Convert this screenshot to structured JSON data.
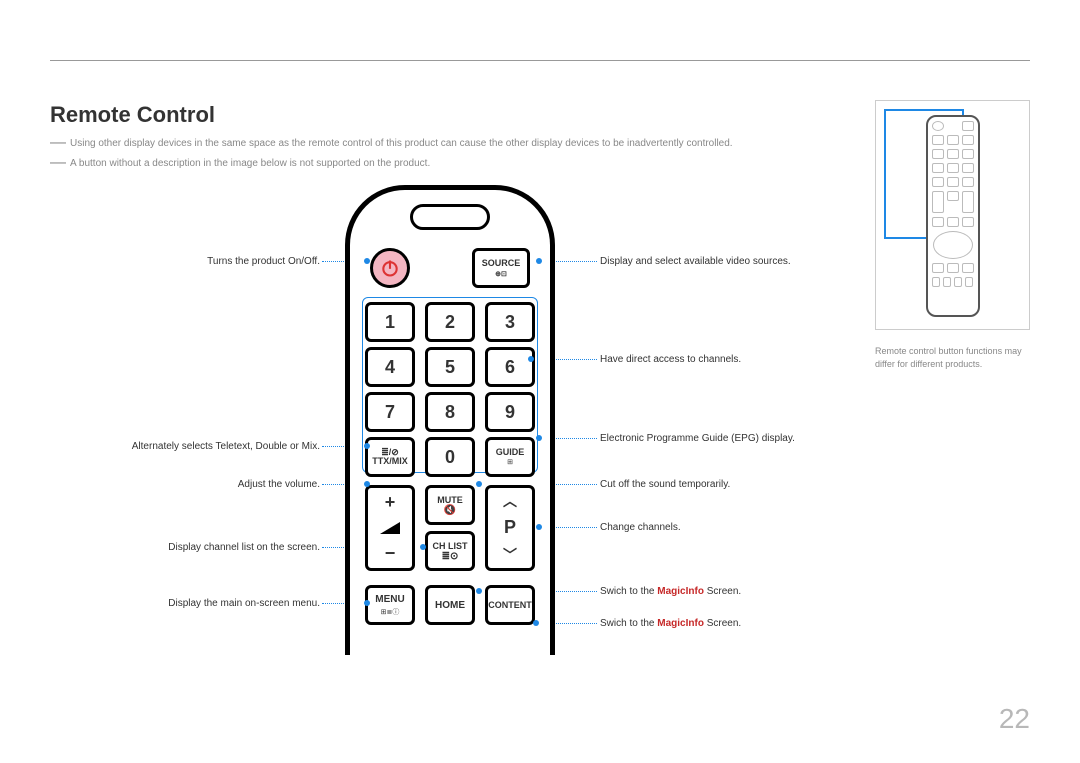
{
  "title": "Remote Control",
  "notes": {
    "n1": "Using other display devices in the same space as the remote control of this product can cause the other display devices to be inadvertently controlled.",
    "n2": "A button without a description in the image below is not supported on the product."
  },
  "callouts": {
    "left": {
      "power": "Turns the product On/Off.",
      "ttx": "Alternately selects Teletext, Double or Mix.",
      "vol": "Adjust the volume.",
      "chlist": "Display channel list on the screen.",
      "menu": "Display the main on-screen menu."
    },
    "right": {
      "source": "Display and select available video sources.",
      "num": "Have direct access to channels.",
      "guide": "Electronic Programme Guide (EPG) display.",
      "mute": "Cut off the sound temporarily.",
      "prog": "Change channels.",
      "home_pre": "Swich to the ",
      "home_b": "MagicInfo",
      "home_post": " Screen.",
      "content_pre": "Swich to the ",
      "content_b": "MagicInfo",
      "content_post": " Screen."
    }
  },
  "buttons": {
    "source": "SOURCE",
    "n1": "1",
    "n2": "2",
    "n3": "3",
    "n4": "4",
    "n5": "5",
    "n6": "6",
    "n7": "7",
    "n8": "8",
    "n9": "9",
    "n0": "0",
    "ttx": "TTX/MIX",
    "guide": "GUIDE",
    "mute": "MUTE",
    "chlist": "CH LIST",
    "p": "P",
    "menu": "MENU",
    "home": "HOME",
    "content": "CONTENT"
  },
  "mini_caption": "Remote control button functions may differ for different products.",
  "page_number": "22"
}
